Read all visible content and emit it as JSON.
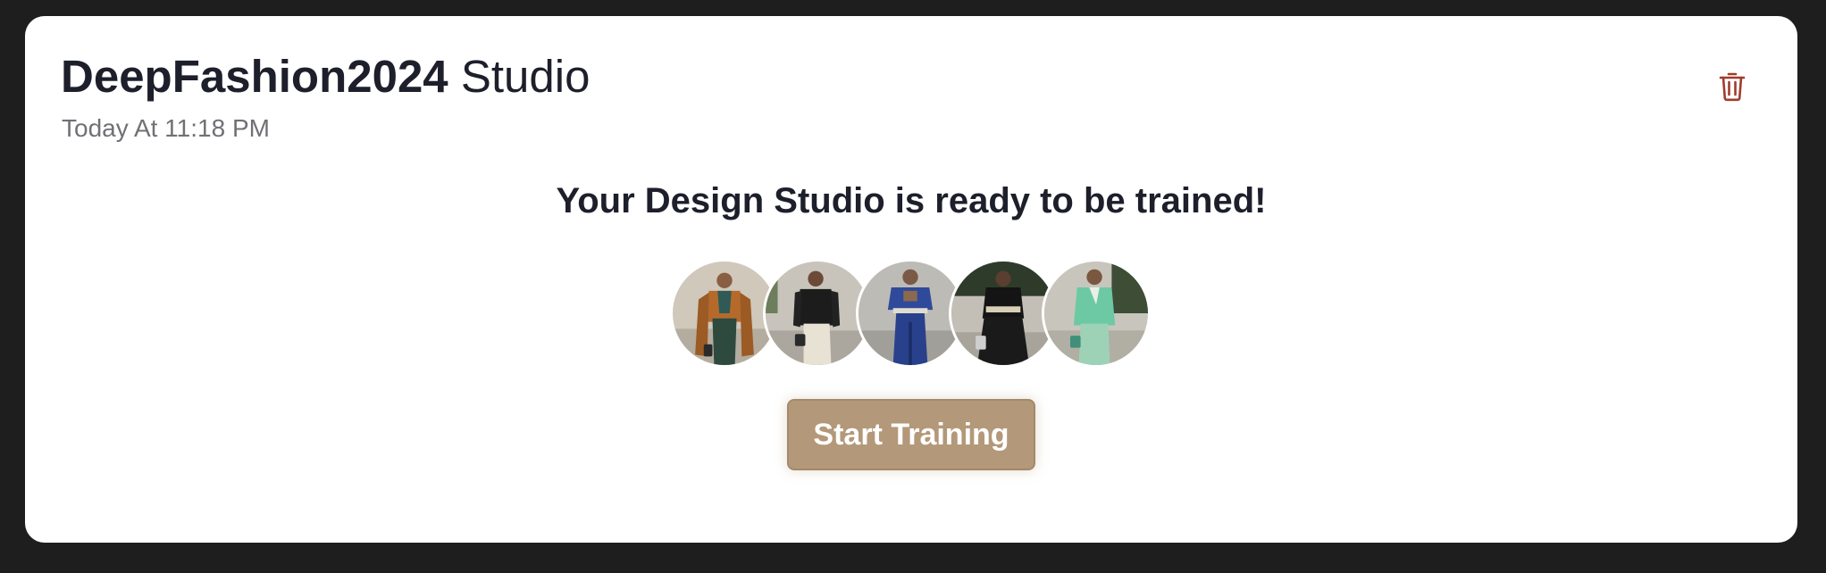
{
  "studio": {
    "name_bold": "DeepFashion2024",
    "name_suffix": "Studio",
    "timestamp": "Today At 11:18 PM"
  },
  "headline": "Your Design Studio is ready to be trained!",
  "preview_images": [
    {
      "outfit": "tan jacket, green trousers"
    },
    {
      "outfit": "black blazer, cream trousers"
    },
    {
      "outfit": "blue satin set"
    },
    {
      "outfit": "black wide-leg set"
    },
    {
      "outfit": "mint green suit"
    }
  ],
  "actions": {
    "start_label": "Start Training",
    "delete_icon": "trash-icon"
  },
  "colors": {
    "accent": "#b39879",
    "delete": "#a23b2c",
    "text": "#1d1f2b",
    "muted": "#6f7175"
  }
}
